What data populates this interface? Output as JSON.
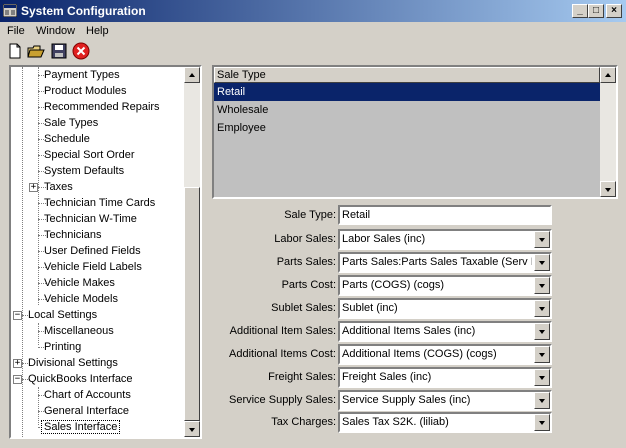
{
  "window": {
    "title": "System Configuration"
  },
  "menu": [
    "File",
    "Window",
    "Help"
  ],
  "toolbar": {
    "icons": [
      "new-icon",
      "open-icon",
      "save-icon",
      "close-red-icon"
    ]
  },
  "tree": {
    "items": [
      {
        "label": "Payment Types"
      },
      {
        "label": "Product Modules"
      },
      {
        "label": "Recommended Repairs"
      },
      {
        "label": "Sale Types"
      },
      {
        "label": "Schedule"
      },
      {
        "label": "Special Sort Order"
      },
      {
        "label": "System Defaults"
      },
      {
        "label": "Taxes"
      },
      {
        "label": "Technician Time Cards"
      },
      {
        "label": "Technician W-Time"
      },
      {
        "label": "Technicians"
      },
      {
        "label": "User Defined Fields"
      },
      {
        "label": "Vehicle Field Labels"
      },
      {
        "label": "Vehicle Makes"
      },
      {
        "label": "Vehicle Models"
      },
      {
        "label": "Local Settings"
      },
      {
        "label": "Miscellaneous"
      },
      {
        "label": "Printing"
      },
      {
        "label": "Divisional Settings"
      },
      {
        "label": "QuickBooks Interface"
      },
      {
        "label": "Chart of Accounts"
      },
      {
        "label": "General Interface"
      },
      {
        "label": "Sales Interface"
      }
    ]
  },
  "sale_types": {
    "header": "Sale Type",
    "rows": [
      "Retail",
      "Wholesale",
      "Employee"
    ],
    "selected": "Retail"
  },
  "form": {
    "sale_type": {
      "label": "Sale Type:",
      "value": "Retail"
    },
    "fields": [
      {
        "label": "Labor Sales:",
        "value": "Labor Sales  (inc)"
      },
      {
        "label": "Parts Sales:",
        "value": "Parts Sales:Parts Sales Taxable (Serv Inv"
      },
      {
        "label": "Parts Cost:",
        "value": "Parts (COGS)  (cogs)"
      },
      {
        "label": "Sublet Sales:",
        "value": "Sublet  (inc)"
      },
      {
        "label": "Additional Item Sales:",
        "value": "Additional Items Sales  (inc)"
      },
      {
        "label": "Additional Items Cost:",
        "value": "Additional Items (COGS)  (cogs)"
      },
      {
        "label": "Freight Sales:",
        "value": "Freight Sales  (inc)"
      },
      {
        "label": "Service Supply Sales:",
        "value": "Service Supply Sales  (inc)"
      },
      {
        "label": "Tax Charges:",
        "value": "Sales Tax S2K. (liliab)"
      }
    ]
  }
}
